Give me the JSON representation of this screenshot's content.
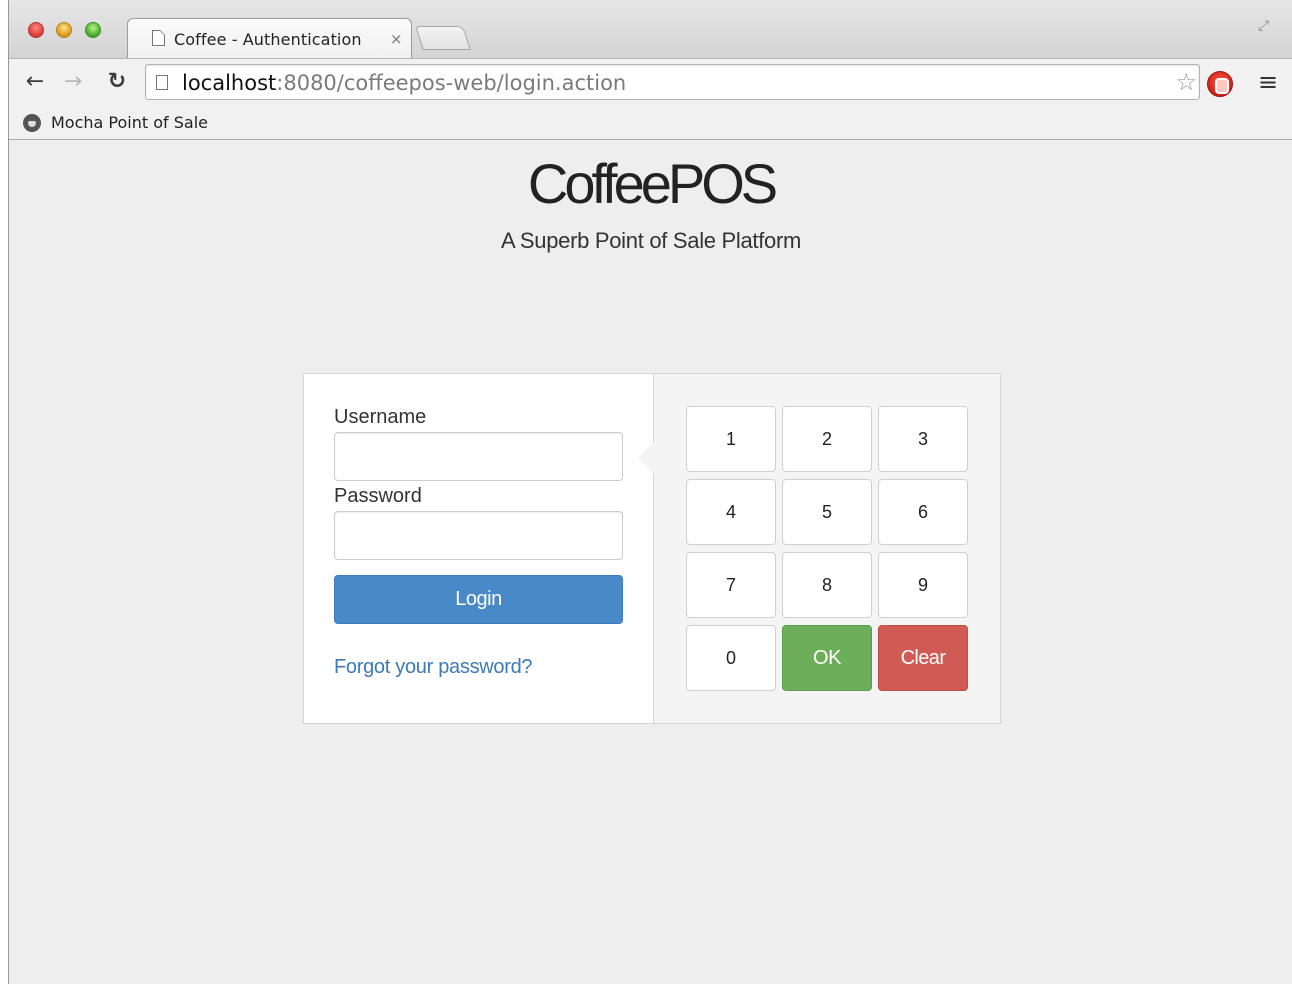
{
  "browser": {
    "tab_title": "Coffee - Authentication",
    "tab_close": "×",
    "url_host": "localhost",
    "url_rest": ":8080/coffeepos-web/login.action",
    "bookmark_label": "Mocha Point of Sale",
    "icons": {
      "back": "back-arrow-icon",
      "forward": "forward-arrow-icon",
      "reload": "reload-icon",
      "star": "bookmark-star-icon",
      "extension": "adblock-icon",
      "menu": "hamburger-menu-icon",
      "fullscreen": "fullscreen-icon"
    }
  },
  "page": {
    "brand": "CoffeePOS",
    "tagline": "A Superb Point of Sale Platform"
  },
  "login_form": {
    "username_label": "Username",
    "username_value": "",
    "password_label": "Password",
    "password_value": "",
    "login_button": "Login",
    "forgot_link": "Forgot your password?",
    "colors": {
      "primary": "#4a89c8",
      "link": "#3d7ab8"
    }
  },
  "keypad": {
    "keys": [
      "1",
      "2",
      "3",
      "4",
      "5",
      "6",
      "7",
      "8",
      "9",
      "0"
    ],
    "ok_label": "OK",
    "clear_label": "Clear",
    "colors": {
      "ok": "#6cae5a",
      "clear": "#cf5b54"
    }
  }
}
